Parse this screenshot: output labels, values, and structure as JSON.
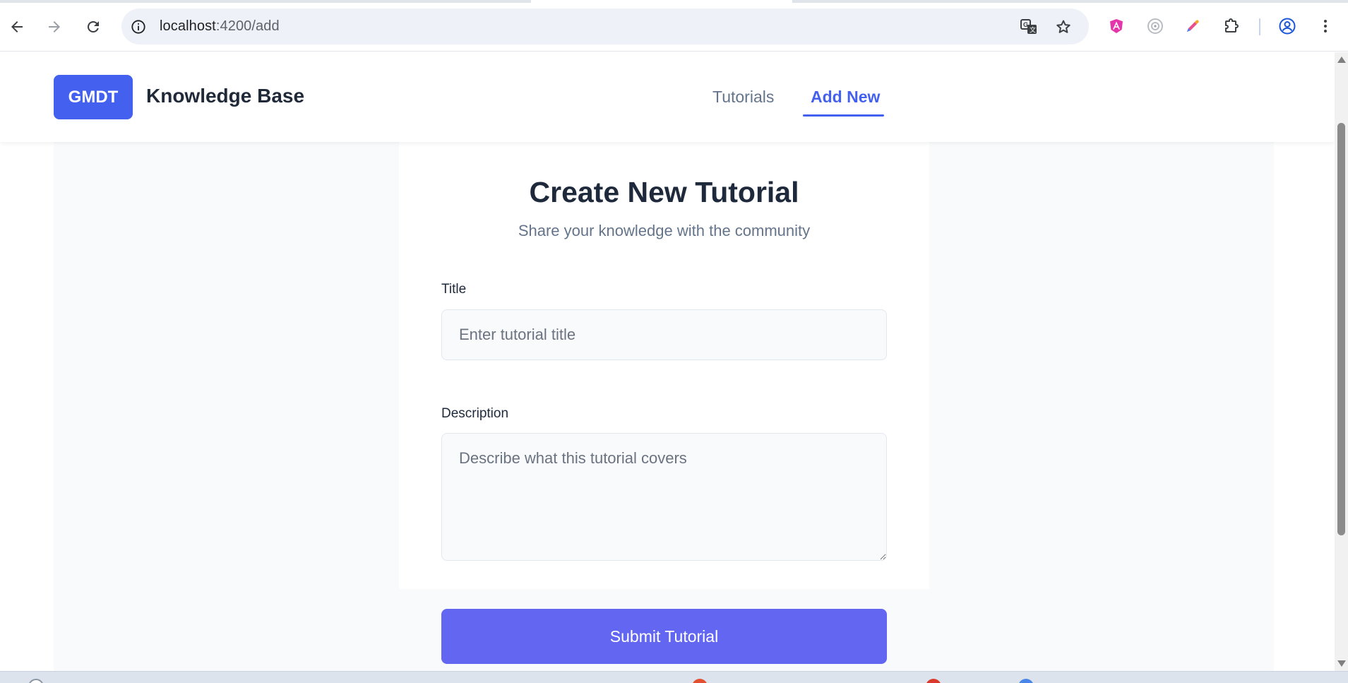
{
  "browser": {
    "url_host": "localhost",
    "url_path": ":4200/add",
    "icons": {
      "back": "arrow-left-icon",
      "forward": "arrow-right-icon",
      "reload": "reload-icon",
      "site_info": "info-icon",
      "translate": "translate-icon",
      "bookmark": "star-icon",
      "ext_angular": "angular-devtools-icon",
      "ext_circle": "extension-circle-icon",
      "ext_color": "color-picker-icon",
      "extensions": "puzzle-icon",
      "profile": "profile-icon",
      "menu": "kebab-menu-icon"
    }
  },
  "header": {
    "logo_text": "GMDT",
    "brand": "Knowledge Base",
    "nav": [
      {
        "label": "Tutorials",
        "active": false
      },
      {
        "label": "Add New",
        "active": true
      }
    ]
  },
  "form": {
    "title": "Create New Tutorial",
    "subtitle": "Share your knowledge with the community",
    "title_label": "Title",
    "title_placeholder": "Enter tutorial title",
    "title_value": "",
    "description_label": "Description",
    "description_placeholder": "Describe what this tutorial covers",
    "description_value": "",
    "submit_label": "Submit Tutorial"
  },
  "colors": {
    "accent": "#4361ee",
    "button": "#6366f1",
    "heading": "#1e293b",
    "muted": "#64748b",
    "page_bg": "#f8fafc"
  }
}
